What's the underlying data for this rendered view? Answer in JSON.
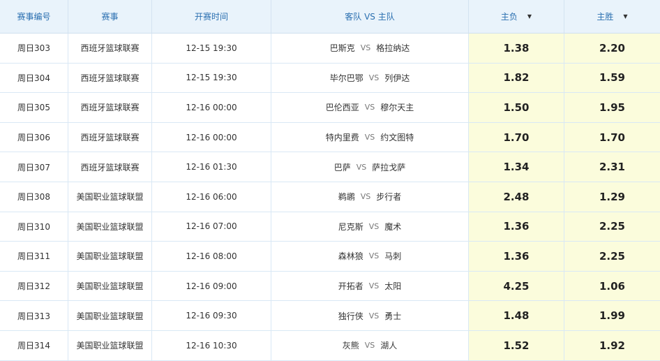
{
  "headers": {
    "id": "赛事编号",
    "league": "赛事",
    "time": "开赛时间",
    "teams": "客队 VS 主队",
    "lose": "主负",
    "win": "主胜",
    "sort_icon": "caret-down-icon"
  },
  "vs": "VS",
  "colors": {
    "header_bg": "#e9f3fb",
    "header_text": "#2a6fb0",
    "odds_bg": "#fbfcdc",
    "border": "#d9e8f5"
  },
  "rows": [
    {
      "id": "周日303",
      "league": "西班牙篮球联赛",
      "time": "12-15 19:30",
      "away": "巴斯克",
      "home": "格拉纳达",
      "lose": "1.38",
      "win": "2.20"
    },
    {
      "id": "周日304",
      "league": "西班牙篮球联赛",
      "time": "12-15 19:30",
      "away": "毕尔巴鄂",
      "home": "列伊达",
      "lose": "1.82",
      "win": "1.59"
    },
    {
      "id": "周日305",
      "league": "西班牙篮球联赛",
      "time": "12-16 00:00",
      "away": "巴伦西亚",
      "home": "穆尔天主",
      "lose": "1.50",
      "win": "1.95"
    },
    {
      "id": "周日306",
      "league": "西班牙篮球联赛",
      "time": "12-16 00:00",
      "away": "特内里费",
      "home": "约文图特",
      "lose": "1.70",
      "win": "1.70"
    },
    {
      "id": "周日307",
      "league": "西班牙篮球联赛",
      "time": "12-16 01:30",
      "away": "巴萨",
      "home": "萨拉戈萨",
      "lose": "1.34",
      "win": "2.31"
    },
    {
      "id": "周日308",
      "league": "美国职业篮球联盟",
      "time": "12-16 06:00",
      "away": "鹈鹕",
      "home": "步行者",
      "lose": "2.48",
      "win": "1.29"
    },
    {
      "id": "周日310",
      "league": "美国职业篮球联盟",
      "time": "12-16 07:00",
      "away": "尼克斯",
      "home": "魔术",
      "lose": "1.36",
      "win": "2.25"
    },
    {
      "id": "周日311",
      "league": "美国职业篮球联盟",
      "time": "12-16 08:00",
      "away": "森林狼",
      "home": "马刺",
      "lose": "1.36",
      "win": "2.25"
    },
    {
      "id": "周日312",
      "league": "美国职业篮球联盟",
      "time": "12-16 09:00",
      "away": "开拓者",
      "home": "太阳",
      "lose": "4.25",
      "win": "1.06"
    },
    {
      "id": "周日313",
      "league": "美国职业篮球联盟",
      "time": "12-16 09:30",
      "away": "独行侠",
      "home": "勇士",
      "lose": "1.48",
      "win": "1.99"
    },
    {
      "id": "周日314",
      "league": "美国职业篮球联盟",
      "time": "12-16 10:30",
      "away": "灰熊",
      "home": "湖人",
      "lose": "1.52",
      "win": "1.92"
    }
  ]
}
